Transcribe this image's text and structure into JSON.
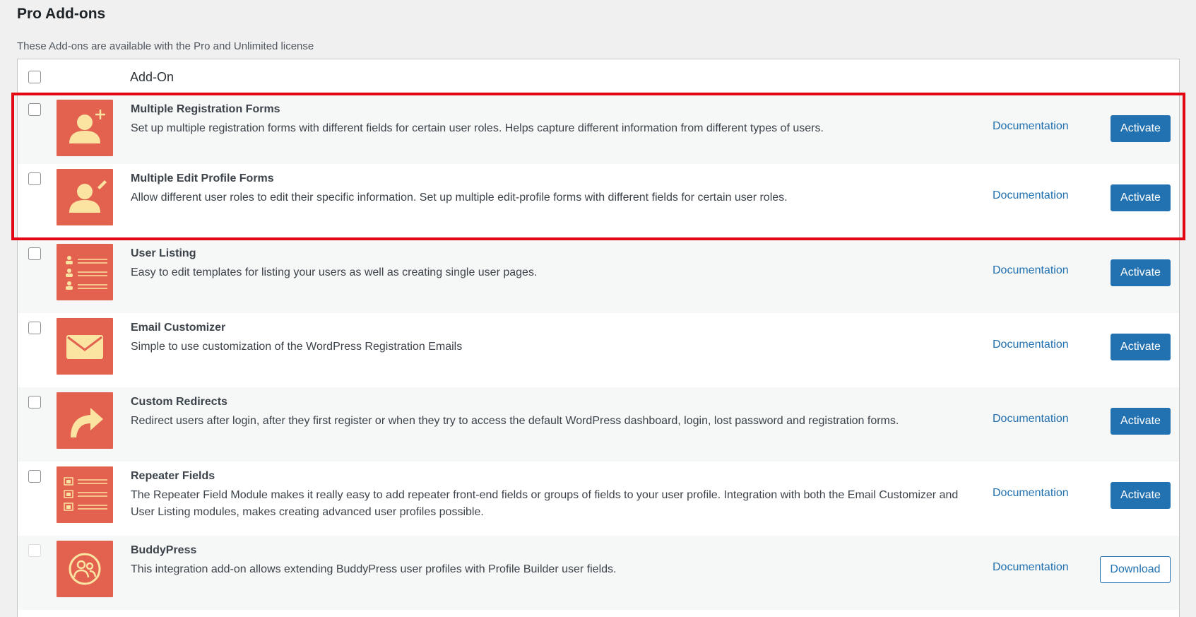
{
  "page": {
    "title": "Pro Add-ons",
    "subtitle": "These Add-ons are available with the Pro and Unlimited license"
  },
  "table": {
    "header": "Add-On",
    "rows": [
      {
        "name": "Multiple Registration Forms",
        "description": "Set up multiple registration forms with different fields for certain user roles. Helps capture different information from different types of users.",
        "doc_label": "Documentation",
        "action_label": "Activate",
        "icon": "user-plus-icon"
      },
      {
        "name": "Multiple Edit Profile Forms",
        "description": "Allow different user roles to edit their specific information. Set up multiple edit-profile forms with different fields for certain user roles.",
        "doc_label": "Documentation",
        "action_label": "Activate",
        "icon": "user-edit-icon"
      },
      {
        "name": "User Listing",
        "description": "Easy to edit templates for listing your users as well as creating single user pages.",
        "doc_label": "Documentation",
        "action_label": "Activate",
        "icon": "user-list-icon"
      },
      {
        "name": "Email Customizer",
        "description": "Simple to use customization of the WordPress Registration Emails",
        "doc_label": "Documentation",
        "action_label": "Activate",
        "icon": "envelope-icon"
      },
      {
        "name": "Custom Redirects",
        "description": "Redirect users after login, after they first register or when they try to access the default WordPress dashboard, login, lost password and registration forms.",
        "doc_label": "Documentation",
        "action_label": "Activate",
        "icon": "redirect-arrow-icon"
      },
      {
        "name": "Repeater Fields",
        "description": "The Repeater Field Module makes it really easy to add repeater front-end fields or groups of fields to your user profile. Integration with both the Email Customizer and User Listing modules, makes creating advanced user profiles possible.",
        "doc_label": "Documentation",
        "action_label": "Activate",
        "icon": "repeater-list-icon"
      },
      {
        "name": "BuddyPress",
        "description": "This integration add-on allows extending BuddyPress user profiles with Profile Builder user fields.",
        "doc_label": "Documentation",
        "action_label": "Download",
        "icon": "buddypress-icon"
      }
    ]
  },
  "colors": {
    "accent": "#2271b1",
    "thumb": "#e2614f",
    "icon_fill": "#fbe3a1",
    "highlight": "#e30613"
  }
}
